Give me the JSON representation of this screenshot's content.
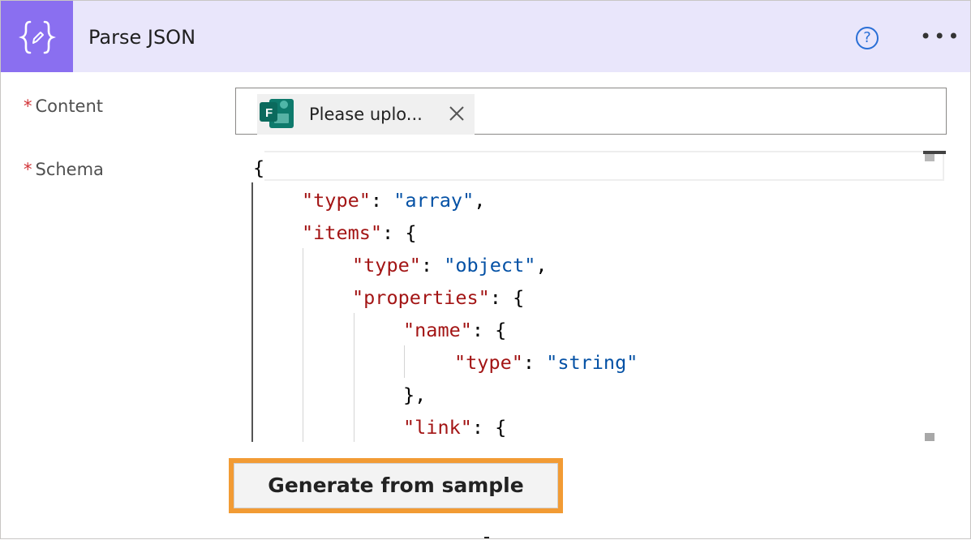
{
  "header": {
    "title": "Parse JSON",
    "icon": "braces-pencil-icon",
    "help_glyph": "?",
    "more_glyph": "•••"
  },
  "colors": {
    "header_bg": "#e9e6fb",
    "icon_bg": "#8a6ff0",
    "required": "#d13438",
    "json_key": "#a31515",
    "json_string": "#0451a5",
    "highlight": "#f29b34"
  },
  "fields": {
    "content": {
      "required_mark": "*",
      "label": "Content",
      "token": {
        "icon": "microsoft-forms-icon",
        "text": "Please uplo..."
      }
    },
    "schema": {
      "required_mark": "*",
      "label": "Schema"
    }
  },
  "schema_code": {
    "line1": "{",
    "line2_key": "\"type\"",
    "line2_sep": ": ",
    "line2_val": "\"array\"",
    "line2_end": ",",
    "line3_key": "\"items\"",
    "line3_end": ": {",
    "line4_key": "\"type\"",
    "line4_sep": ": ",
    "line4_val": "\"object\"",
    "line4_end": ",",
    "line5_key": "\"properties\"",
    "line5_end": ": {",
    "line6_key": "\"name\"",
    "line6_end": ": {",
    "line7_key": "\"type\"",
    "line7_sep": ": ",
    "line7_val": "\"string\"",
    "line8": "},",
    "line9_key": "\"link\"",
    "line9_end": ": {"
  },
  "buttons": {
    "generate_label": "Generate from sample"
  }
}
